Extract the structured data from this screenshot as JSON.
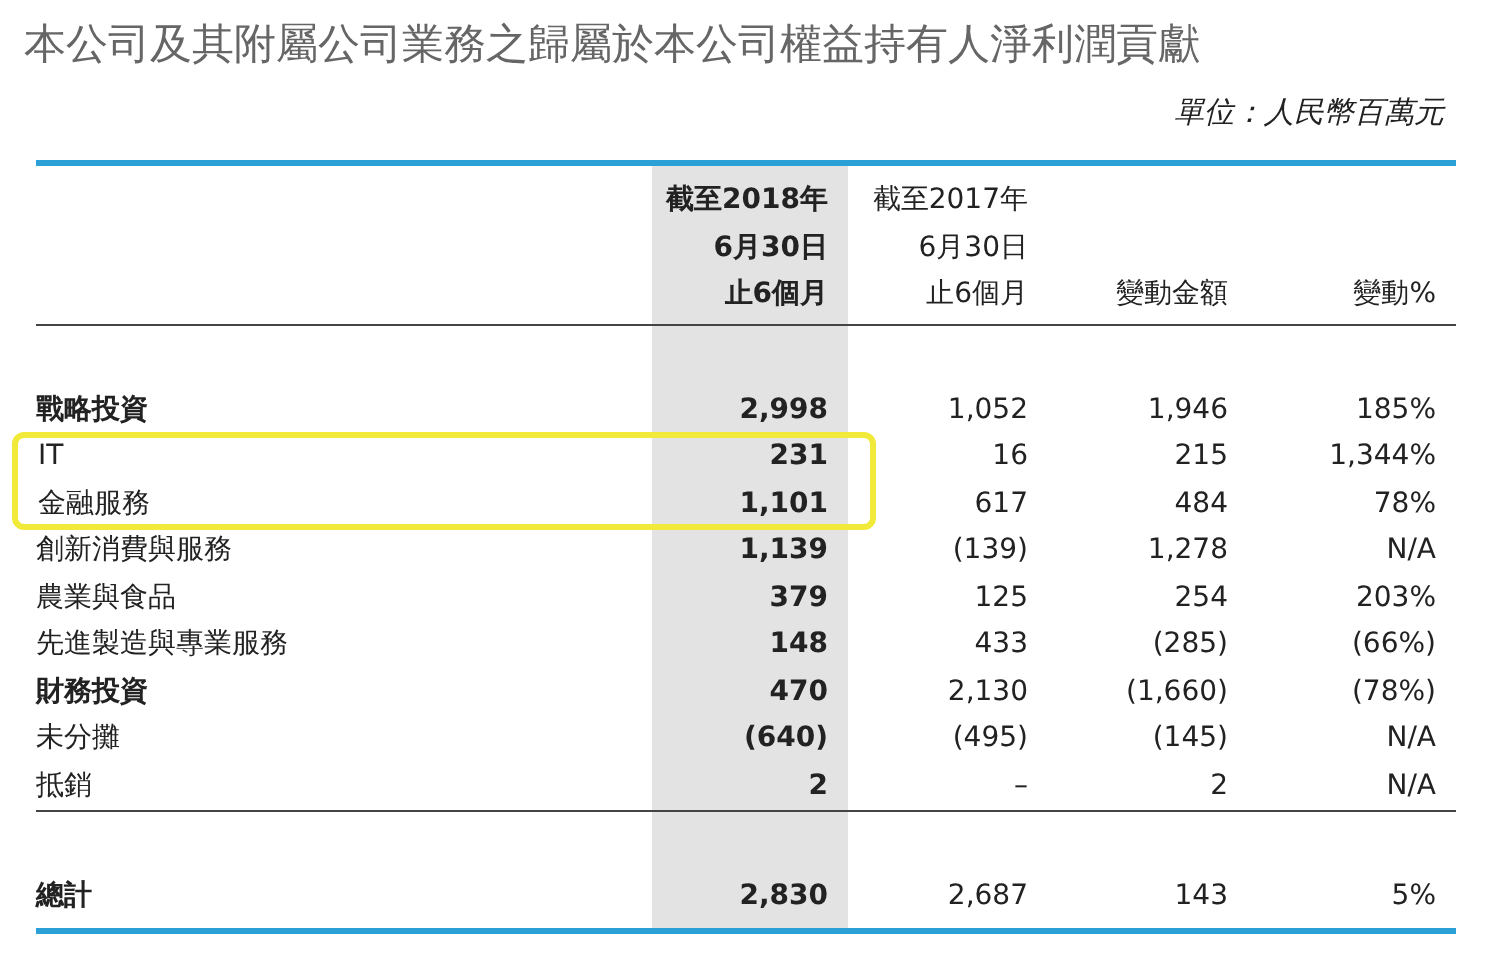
{
  "title": "本公司及其附屬公司業務之歸屬於本公司權益持有人淨利潤貢獻",
  "unit": "單位：人民幣百萬元",
  "table": {
    "columns": [
      {
        "lines": [
          "截至2018年",
          "6月30日",
          "止6個月"
        ],
        "selected": true
      },
      {
        "lines": [
          "截至2017年",
          "6月30日",
          "止6個月"
        ],
        "selected": false
      },
      {
        "lines": [
          "變動金額"
        ],
        "selected": false
      },
      {
        "lines": [
          "變動%"
        ],
        "selected": false
      }
    ],
    "rows": [
      {
        "label": "戰略投資",
        "values": [
          "2,998",
          "1,052",
          "1,946",
          "185%"
        ],
        "kind": "group"
      },
      {
        "label": "IT",
        "values": [
          "231",
          "16",
          "215",
          "1,344%"
        ],
        "kind": "item",
        "highlighted": true
      },
      {
        "label": "金融服務",
        "values": [
          "1,101",
          "617",
          "484",
          "78%"
        ],
        "kind": "item",
        "highlighted": true
      },
      {
        "label": "創新消費與服務",
        "values": [
          "1,139",
          "(139)",
          "1,278",
          "N/A"
        ],
        "kind": "item"
      },
      {
        "label": "農業與食品",
        "values": [
          "379",
          "125",
          "254",
          "203%"
        ],
        "kind": "item"
      },
      {
        "label": "先進製造與專業服務",
        "values": [
          "148",
          "433",
          "(285)",
          "(66%)"
        ],
        "kind": "item"
      },
      {
        "label": "財務投資",
        "values": [
          "470",
          "2,130",
          "(1,660)",
          "(78%)"
        ],
        "kind": "group"
      },
      {
        "label": "未分攤",
        "values": [
          "(640)",
          "(495)",
          "(145)",
          "N/A"
        ],
        "kind": "item"
      },
      {
        "label": "抵銷",
        "values": [
          "2",
          "–",
          "2",
          "N/A"
        ],
        "kind": "item"
      }
    ],
    "total": {
      "label": "總計",
      "values": [
        "2,830",
        "2,687",
        "143",
        "5%"
      ],
      "kind": "group"
    }
  }
}
